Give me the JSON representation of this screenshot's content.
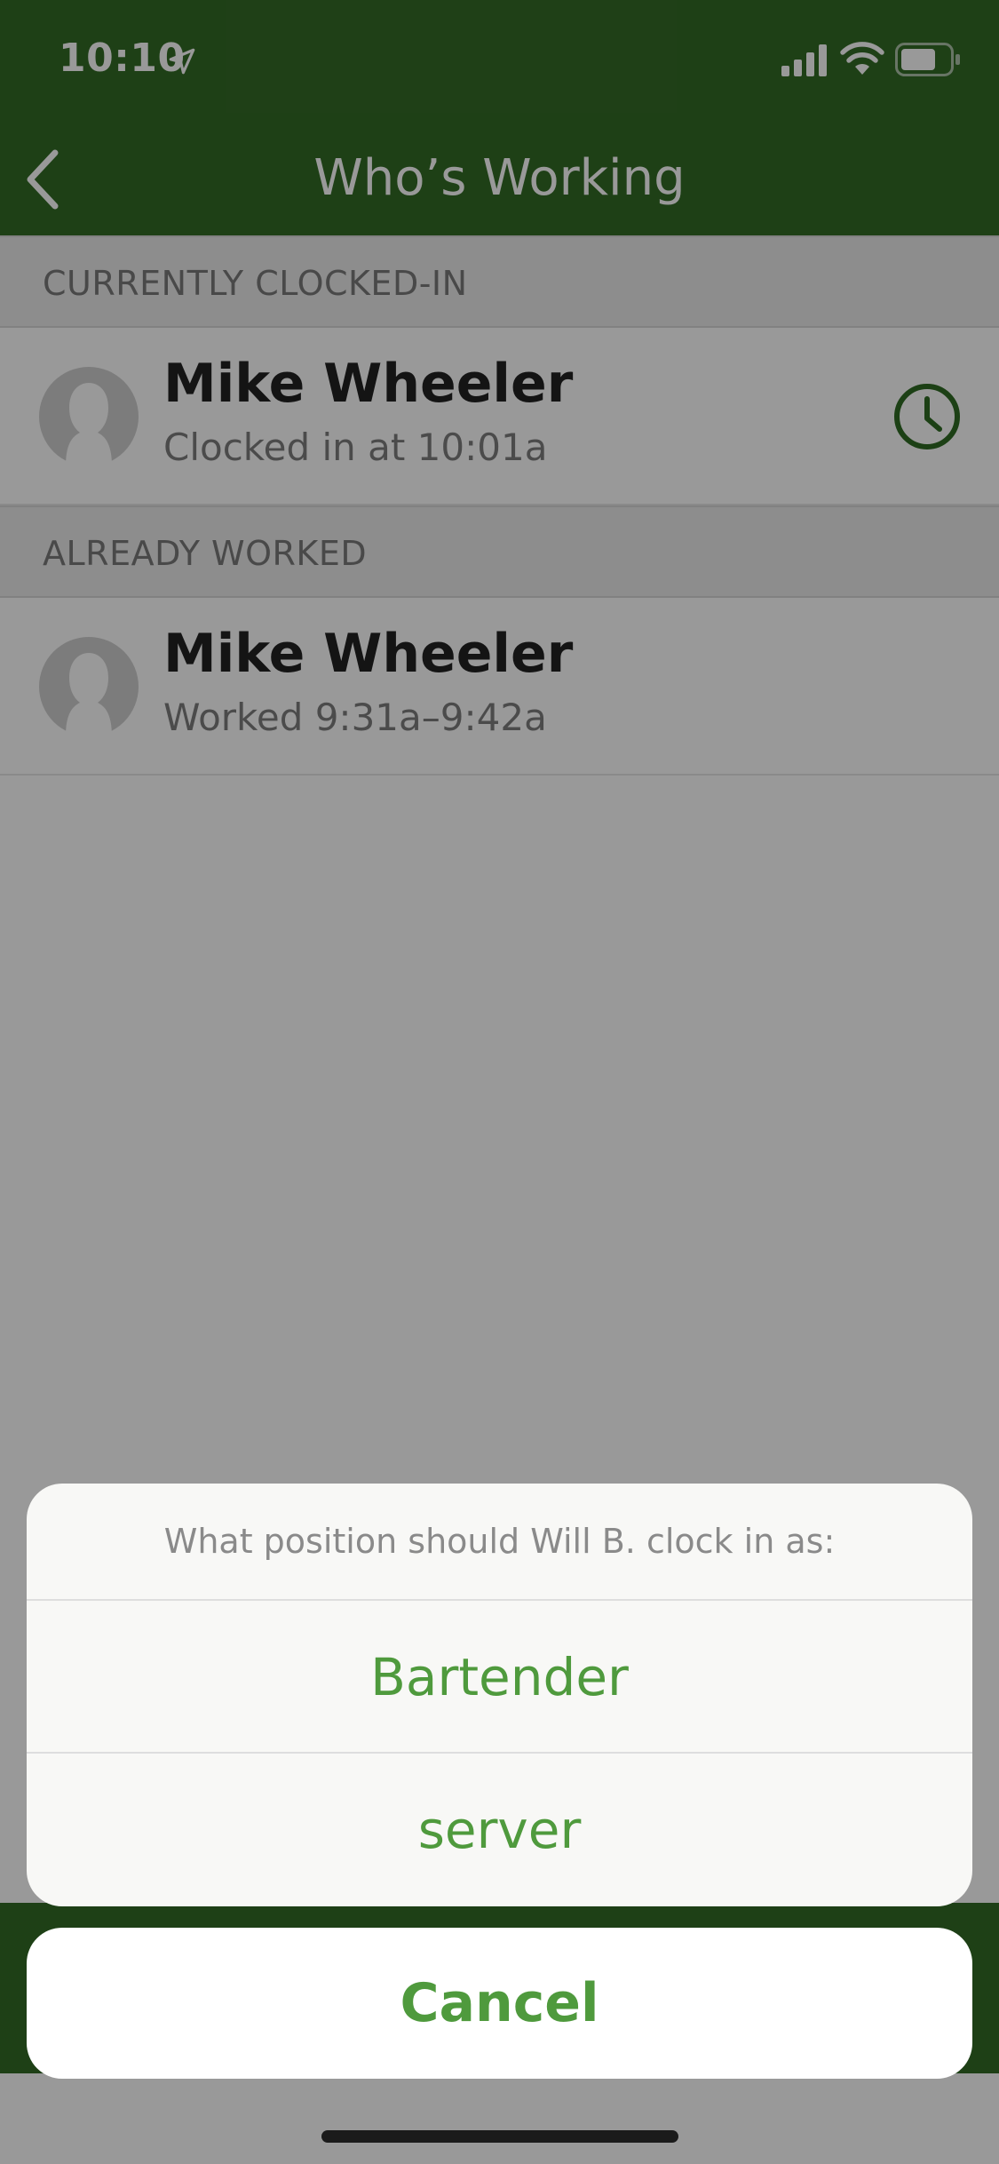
{
  "status_bar": {
    "time": "10:10"
  },
  "nav": {
    "title": "Who’s Working"
  },
  "sections": [
    {
      "header": "CURRENTLY CLOCKED-IN",
      "rows": [
        {
          "name": "Mike Wheeler",
          "subtitle": "Clocked in at 10:01a"
        }
      ]
    },
    {
      "header": "ALREADY WORKED",
      "rows": [
        {
          "name": "Mike Wheeler",
          "subtitle": "Worked 9:31a–9:42a"
        }
      ]
    }
  ],
  "action_sheet": {
    "title": "What position should Will B. clock in as:",
    "options": [
      "Bartender",
      "server"
    ],
    "cancel_label": "Cancel"
  },
  "colors": {
    "brand_green": "#336b26",
    "action_green": "#4f9a3d"
  },
  "icons": {
    "back": "chevron-left-icon",
    "clock": "clock-icon",
    "avatar": "avatar-placeholder-icon"
  }
}
